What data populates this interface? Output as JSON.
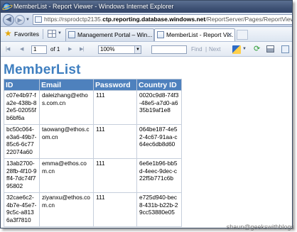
{
  "window": {
    "title": "MemberList - Report Viewer - Windows Internet Explorer"
  },
  "address_bar": {
    "url_prefix": "https://rsprodctp2135.",
    "url_host": "ctp.reporting.database.windows.net",
    "url_path": "/ReportServer/Pages/ReportViewer.aspx?/"
  },
  "favorites_bar": {
    "favorites_label": "Favorites",
    "tabs": [
      {
        "label": "Management Portal – Win..."
      },
      {
        "label": "MemberList - Report Vi..."
      }
    ]
  },
  "report_toolbar": {
    "page_number": "1",
    "of_pages": "of 1",
    "zoom": "100%",
    "find_label": "Find",
    "find_separator": "|",
    "next_label": "Next"
  },
  "report": {
    "title": "MemberList",
    "columns": [
      "ID",
      "Email",
      "Password",
      "Country ID"
    ],
    "rows": [
      [
        "c07e4b97-fa2e-438b-82e5-02055fb6bf6a",
        "daleizhang@ethos.com.cn",
        "111",
        "0020c9d8-74f3-48e5-a7d0-a635b19af1e8"
      ],
      [
        "bc50c064-e3a6-49b7-85c6-6c7722074a60",
        "taowang@ethos.com.cn",
        "111",
        "064be187-4e52-4c67-91aa-c64ec6db8d60"
      ],
      [
        "13ab2700-28fb-4f10-9ff4-7dc74f795802",
        "emma@ethos.com.cn",
        "111",
        "6e6e1b96-bb5d-4eec-9dec-c22f5b771c6b"
      ],
      [
        "32cae6c2-4b7e-45e7-9c5c-a8136a3f7810",
        "ziyanxu@ethos.com.cn",
        "111",
        "e725d940-bec8-431b-b22b-29cc53880e05"
      ]
    ]
  },
  "watermark": "shaun@geekswithblogs",
  "colors": {
    "header_bg": "#4e81bd",
    "title_color": "#3f7fc0",
    "titlebar": "#3f5275"
  },
  "icons": [
    "ie-logo-icon",
    "back-arrow-icon",
    "forward-arrow-icon",
    "favorites-star-icon",
    "quick-tabs-icon",
    "first-page-icon",
    "prev-page-icon",
    "next-page-icon",
    "last-page-icon",
    "export-icon",
    "refresh-icon",
    "print-icon",
    "atom-feed-icon"
  ]
}
